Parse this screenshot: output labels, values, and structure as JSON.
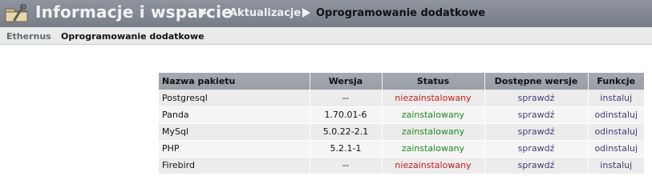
{
  "header": {
    "title": "Informacje i wsparcie",
    "breadcrumb": [
      "Aktualizacje",
      "Oprogramowanie dodatkowe"
    ],
    "icon": "folder-wrench-icon"
  },
  "subnav": {
    "app": "Ethernus",
    "page": "Oprogramowanie dodatkowe"
  },
  "table": {
    "columns": [
      "Nazwa pakietu",
      "Wersja",
      "Status",
      "Dostępne wersje",
      "Funkcje"
    ],
    "rows": [
      {
        "name": "Postgresql",
        "version": "--",
        "status": "niezainstalowany",
        "available": "sprawdź",
        "action": "instaluj"
      },
      {
        "name": "Panda",
        "version": "1.70.01-6",
        "status": "zainstalowany",
        "available": "sprawdź",
        "action": "odinstaluj"
      },
      {
        "name": "MySql",
        "version": "5.0.22-2.1",
        "status": "zainstalowany",
        "available": "sprawdź",
        "action": "odinstaluj"
      },
      {
        "name": "PHP",
        "version": "5.2.1-1",
        "status": "zainstalowany",
        "available": "sprawdź",
        "action": "odinstaluj"
      },
      {
        "name": "Firebird",
        "version": "--",
        "status": "niezainstalowany",
        "available": "sprawdź",
        "action": "instaluj"
      }
    ]
  },
  "colors": {
    "header_bg": "#858a94",
    "table_header_bg": "#a0a4ac",
    "installed": "#1f8a1f",
    "not_installed": "#cc1b1b",
    "link": "#3d3d77"
  }
}
